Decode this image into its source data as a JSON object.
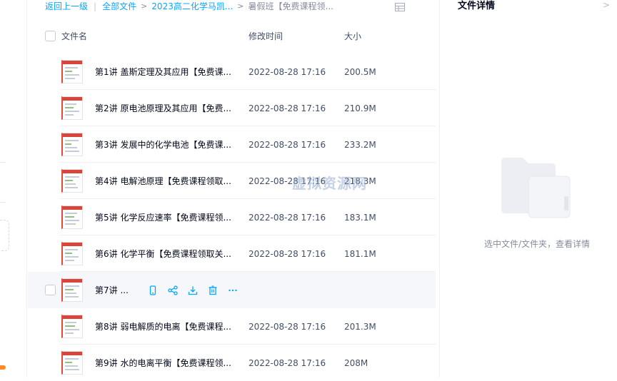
{
  "breadcrumb": {
    "back": "返回上一级",
    "all": "全部文件",
    "folder": "2023高二化学马凯...",
    "current": "暑假班【免费课程领..."
  },
  "table": {
    "col_name": "文件名",
    "col_time": "修改时间",
    "col_size": "大小"
  },
  "files": [
    {
      "name": "第1讲 盖斯定理及其应用【免费课...",
      "time": "2022-08-28 17:16",
      "size": "200.5M"
    },
    {
      "name": "第2讲 原电池原理及其应用【免费...",
      "time": "2022-08-28 17:16",
      "size": "210.9M"
    },
    {
      "name": "第3讲 发展中的化学电池【免费课...",
      "time": "2022-08-28 17:16",
      "size": "233.2M"
    },
    {
      "name": "第4讲 电解池原理【免费课程领取...",
      "time": "2022-08-28 17:16",
      "size": "218.3M"
    },
    {
      "name": "第5讲 化学反应速率【免费课程领...",
      "time": "2022-08-28 17:16",
      "size": "183.1M"
    },
    {
      "name": "第6讲 化学平衡【免费课程领取关...",
      "time": "2022-08-28 17:16",
      "size": "181.1M"
    },
    {
      "name": "第7讲 ...",
      "time": "",
      "size": ""
    },
    {
      "name": "第8讲 弱电解质的电离【免费课程...",
      "time": "2022-08-28 17:16",
      "size": "201.3M"
    },
    {
      "name": "第9讲 水的电离平衡【免费课程领...",
      "time": "2022-08-28 17:16",
      "size": "208M"
    }
  ],
  "hover_actions": [
    "phone-icon",
    "share-icon",
    "download-icon",
    "delete-icon",
    "more-icon"
  ],
  "watermark": "虚拟资源网",
  "detail": {
    "title": "文件详情",
    "empty_text": "选中文件/文件夹，查看详情"
  },
  "colors": {
    "accent": "#06a7ff",
    "hover_row": "#f5f7fa",
    "sidebar_badge": "#ff8a2a"
  }
}
